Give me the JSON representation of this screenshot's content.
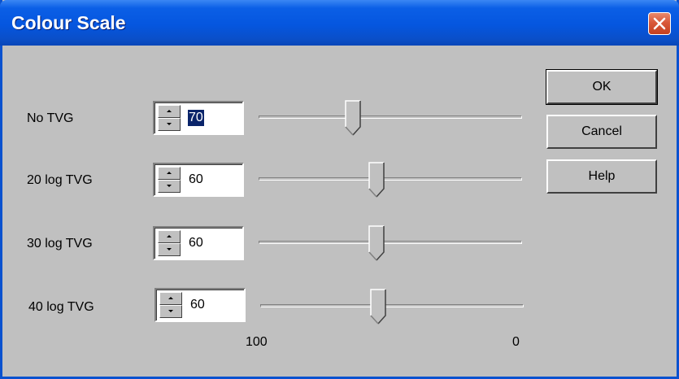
{
  "window": {
    "title": "Colour Scale",
    "close_icon": "close-icon"
  },
  "rows": [
    {
      "label": "No TVG",
      "value": "70",
      "selected": true,
      "slider_fraction": 0.32
    },
    {
      "label": "20 log TVG",
      "value": "60",
      "selected": false,
      "slider_fraction": 0.41
    },
    {
      "label": "30 log TVG",
      "value": "60",
      "selected": false,
      "slider_fraction": 0.41
    },
    {
      "label": "40 log TVG",
      "value": "60",
      "selected": false,
      "slider_fraction": 0.41
    }
  ],
  "scale": {
    "left_label": "100",
    "right_label": "0"
  },
  "buttons": {
    "ok": "OK",
    "cancel": "Cancel",
    "help": "Help"
  },
  "colors": {
    "title_bar": "#0556df",
    "dialog_face": "#c0c0c0",
    "selection": "#0a246a",
    "close_button": "#d9583a"
  }
}
